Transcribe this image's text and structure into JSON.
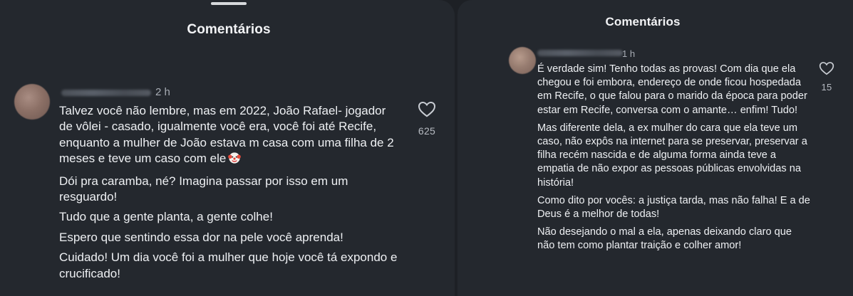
{
  "left_panel": {
    "title": "Comentários",
    "comment": {
      "time": "2 h",
      "paragraphs": [
        "Talvez você não lembre, mas em 2022, João Rafael- jogador de vôlei - casado, igualmente você era, você foi até Recife, enquanto a mulher de João estava m casa com uma filha de 2 meses e teve um caso com ele",
        "Dói pra caramba, né? Imagina passar por isso em um resguardo!",
        "Tudo que a gente planta, a gente colhe!",
        "Espero que sentindo essa dor na pele você aprenda!",
        "Cuidado! Um dia você foi a mulher que hoje você tá expondo e crucificado!"
      ],
      "emoji": "clown-face-icon",
      "like_count": "625"
    }
  },
  "right_panel": {
    "title": "Comentários",
    "comment": {
      "time": "1 h",
      "paragraphs": [
        "É verdade sim! Tenho todas as provas! Com dia que ela chegou e foi embora, endereço de onde ficou hospedada em Recife, o que falou para o marido da época para poder estar em Recife, conversa com o amante… enfim! Tudo!",
        "Mas diferente dela, a ex mulher do cara que ela teve um caso, não expôs na internet para se preservar, preservar a filha recém nascida e de alguma forma ainda teve a empatia de não expor as pessoas públicas envolvidas na história!",
        "Como dito por vocês: a justiça tarda, mas não falha! E a de Deus é a melhor de todas!",
        "Não desejando o mal a ela, apenas deixando claro que não tem como plantar traição e colher amor!"
      ],
      "like_count": "15"
    }
  },
  "colors": {
    "background": "#1d2025",
    "panel": "#24282e",
    "text": "#eef0f3",
    "muted": "#a8adb5"
  }
}
